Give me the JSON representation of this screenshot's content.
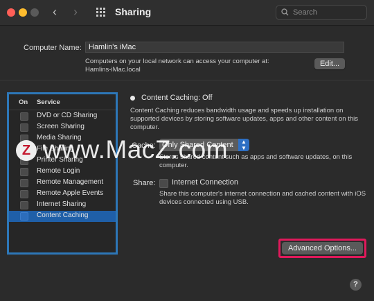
{
  "window": {
    "title": "Sharing",
    "search_placeholder": "Search"
  },
  "computer": {
    "name_label": "Computer Name:",
    "name_value": "Hamlin's iMac",
    "desc_line1": "Computers on your local network can access your computer at:",
    "desc_line2": "Hamlins-iMac.local",
    "edit_label": "Edit..."
  },
  "services": {
    "header_on": "On",
    "header_service": "Service",
    "items": [
      {
        "label": "DVD or CD Sharing"
      },
      {
        "label": "Screen Sharing"
      },
      {
        "label": "Media Sharing"
      },
      {
        "label": "File Sharing"
      },
      {
        "label": "Printer Sharing"
      },
      {
        "label": "Remote Login"
      },
      {
        "label": "Remote Management"
      },
      {
        "label": "Remote Apple Events"
      },
      {
        "label": "Internet Sharing"
      },
      {
        "label": "Content Caching"
      }
    ],
    "selected": "Content Caching"
  },
  "content_caching": {
    "status": "Content Caching: Off",
    "description": "Content Caching reduces bandwidth usage and speeds up installation on supported devices by storing software updates, apps and other content on this computer.",
    "cache_label": "Cache:",
    "cache_value": "Only Shared Content",
    "cache_description": "Stores shared content such as apps and software updates, on this computer.",
    "share_label": "Share:",
    "share_option": "Internet Connection",
    "share_description": "Share this computer's internet connection and cached content with iOS devices connected using USB.",
    "advanced_label": "Advanced Options...",
    "help_label": "?"
  },
  "watermark": {
    "logo_letter": "Z",
    "text": "www.MacZ.com"
  },
  "colors": {
    "accent": "#2d77b8",
    "selection": "#1f5fa8",
    "highlight": "#e0195b"
  }
}
